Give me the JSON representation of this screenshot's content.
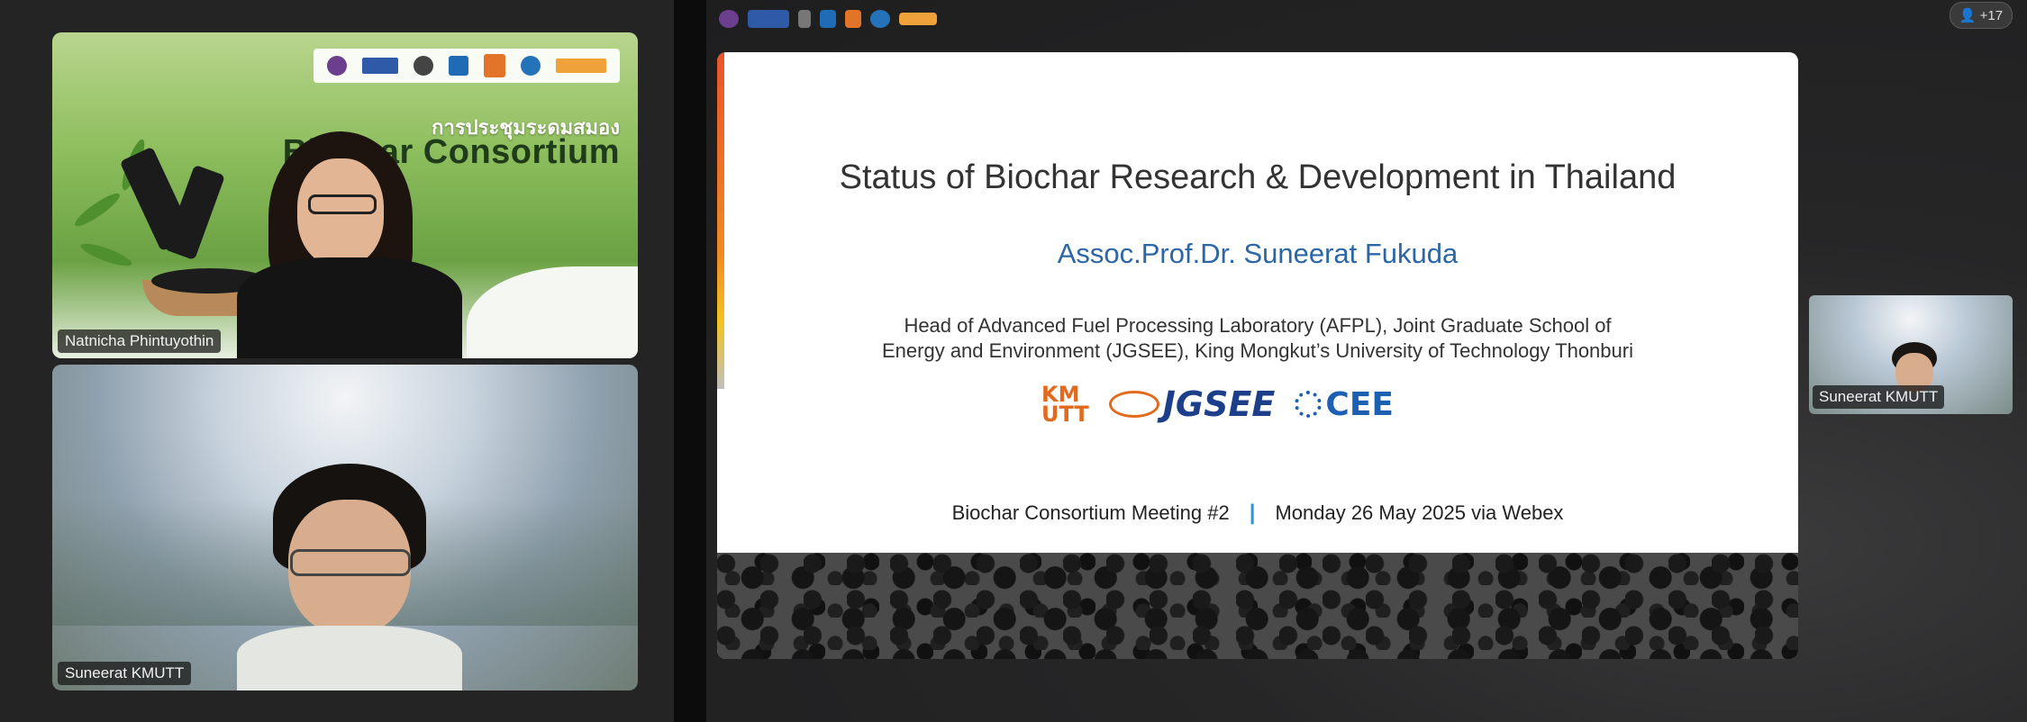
{
  "left_panel": {
    "tiles": [
      {
        "name": "Natnicha Phintuyothin",
        "banner_thai": "การประชุมระดมสมอง",
        "banner_title": "Biochar Consortium"
      },
      {
        "name": "Suneerat KMUTT"
      }
    ]
  },
  "right_panel": {
    "participants_count": "+17",
    "slide": {
      "title": "Status of Biochar Research & Development in Thailand",
      "author": "Assoc.Prof.Dr. Suneerat Fukuda",
      "affiliation_line1": "Head of Advanced Fuel Processing Laboratory (AFPL), Joint Graduate School of",
      "affiliation_line2": "Energy and Environment (JGSEE), King Mongkut’s University of Technology Thonburi",
      "logo_kmutt_1": "KM",
      "logo_kmutt_2": "UTT",
      "logo_jgsee": "JGSEE",
      "logo_cee": "CEE",
      "footer_event": "Biochar Consortium Meeting #2",
      "footer_separator": "|",
      "footer_date": "Monday 26 May 2025 via Webex"
    },
    "self_view": {
      "name": "Suneerat KMUTT"
    }
  },
  "colors": {
    "author_blue": "#2c66a7",
    "slide_accent": "#e8542a",
    "separator": "#2c9ad8"
  }
}
